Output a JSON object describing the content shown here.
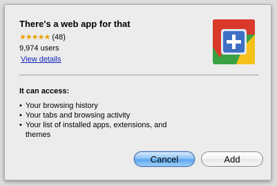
{
  "dialog": {
    "title": "There's a web app for that",
    "rating": {
      "stars": "★★★★★",
      "count": "(48)"
    },
    "users": "9,974 users",
    "view_details": "View details",
    "icon": "web-app-plus-icon",
    "access_heading": "It can access:",
    "permissions": [
      "Your browsing history",
      "Your tabs and browsing activity",
      "Your list of installed apps, extensions, and themes"
    ],
    "bullet": "•",
    "buttons": {
      "cancel": "Cancel",
      "add": "Add"
    }
  },
  "colors": {
    "link": "#0b1fb8",
    "stars": "#e8a100",
    "icon_red": "#d9392b",
    "icon_yellow": "#f4c21a",
    "icon_green": "#3aa043",
    "icon_blue": "#3d6fc4"
  }
}
